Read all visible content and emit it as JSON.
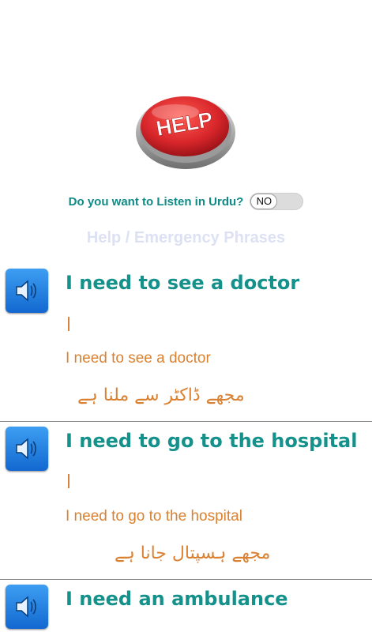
{
  "header": {
    "help_button_text": "HELP",
    "listen_prompt": "Do you want to Listen in Urdu?",
    "listen_toggle_state": "NO",
    "section_title": "Help / Emergency Phrases"
  },
  "phrases": [
    {
      "english": "I need to see a doctor",
      "transliteration": "I need to see a doctor",
      "urdu": "مجھے ڈاکٹر سے ملنا ہے"
    },
    {
      "english": "I need to go to the hospital",
      "transliteration": "I need to go to the hospital",
      "urdu": "مجھے ہسپتال جانا ہے"
    },
    {
      "english": "I need an ambulance"
    }
  ],
  "icons": {
    "speaker": "speaker-icon",
    "help": "help-button-icon"
  },
  "colors": {
    "accent_teal": "#14918a",
    "translit_orange": "#d98233",
    "speaker_blue": "#1f7fe0",
    "help_red": "#d8262b"
  }
}
